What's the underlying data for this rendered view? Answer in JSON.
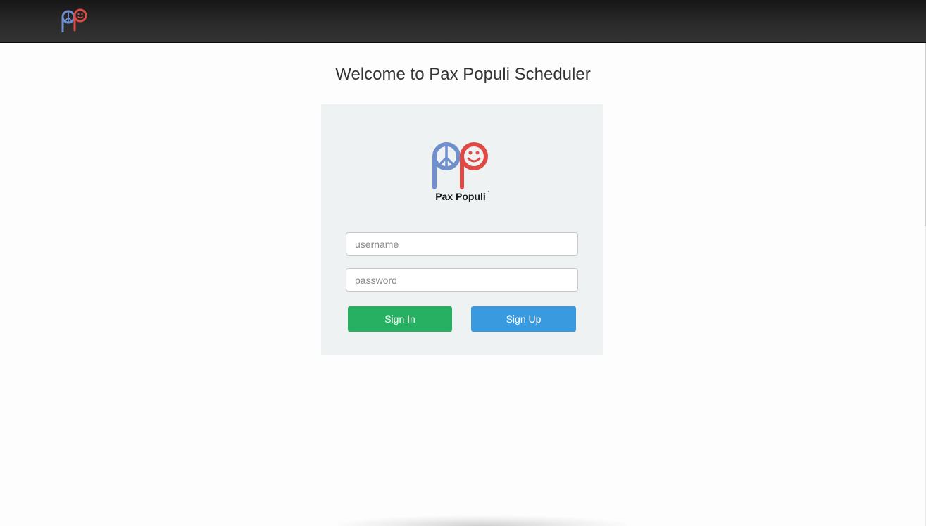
{
  "navbar": {
    "logo_icon": "pax-populi-logo-icon"
  },
  "main": {
    "title": "Welcome to Pax Populi Scheduler"
  },
  "login_card": {
    "logo_icon": "pax-populi-logo-icon",
    "logo_text": "Pax Populi",
    "username": {
      "placeholder": "username",
      "value": ""
    },
    "password": {
      "placeholder": "password",
      "value": ""
    },
    "sign_in_label": "Sign In",
    "sign_up_label": "Sign Up"
  },
  "colors": {
    "navbar": "#222222",
    "card_background": "#eef2f2",
    "sign_in": "#28b062",
    "sign_up": "#3a9ae0",
    "logo_blue": "#6f8fcd",
    "logo_red": "#e04a44"
  }
}
